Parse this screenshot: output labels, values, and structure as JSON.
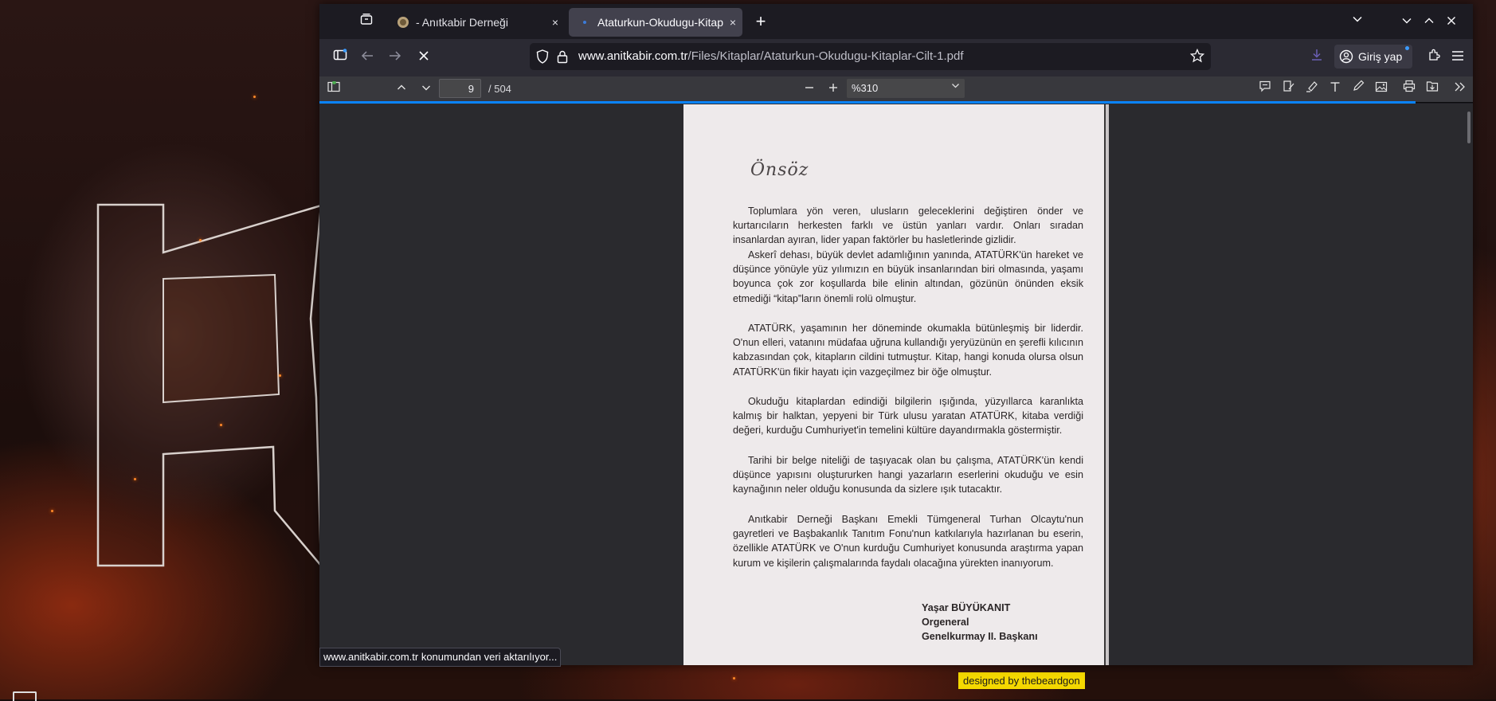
{
  "desktop": {
    "credit": "designed by thebeardgon"
  },
  "browser": {
    "tabs": [
      {
        "title": "- Anıtkabir Derneği",
        "close": "×",
        "active": false
      },
      {
        "title": "Ataturkun-Okudugu-Kitapl",
        "close": "×",
        "active": true
      }
    ],
    "new_tab": "+",
    "url": {
      "domain": "www.anitkabir.com.tr",
      "path": "/Files/Kitaplar/Ataturkun-Okudugu-Kitaplar-Cilt-1.pdf"
    },
    "account_label": "Giriş yap",
    "status_text": "www.anitkabir.com.tr konumundan veri aktarılıyor...",
    "accent_color": "#0a84ff"
  },
  "pdf_viewer": {
    "page_number": "9",
    "page_count": "/ 504",
    "zoom": "%310"
  },
  "document": {
    "heading": "Önsöz",
    "paragraphs": [
      "Toplumlara yön veren, ulusların geleceklerini değiştiren önder ve kurtarıcıların herkesten farklı ve üstün yanları vardır. Onları sıradan insanlardan ayıran, lider yapan faktörler bu hasletlerinde gizlidir.",
      "Askerî dehası, büyük devlet adamlığının yanında, ATATÜRK'ün hareket ve düşünce yönüyle yüz yılımızın en büyük insanlarından biri olmasında, yaşamı boyunca çok zor koşullarda bile elinin altından, gözünün önünden eksik etmediği “kitap”ların önemli rolü olmuştur.",
      "ATATÜRK, yaşamının her döneminde okumakla bütünleşmiş bir liderdir. O'nun elleri, vatanını müdafaa uğruna kullandığı yeryüzünün en şerefli kılıcının kabzasından çok, kitapların cildini tutmuştur. Kitap, hangi konuda olursa olsun ATATÜRK'ün fikir hayatı için vazgeçilmez bir öğe olmuştur.",
      "Okuduğu kitaplardan edindiği bilgilerin ışığında, yüzyıllarca karanlıkta kalmış bir halktan, yepyeni bir Türk ulusu yaratan ATATÜRK, kitaba verdiği değeri, kurduğu Cumhuriyet'in temelini kültüre dayandırmakla göstermiştir.",
      "Tarihi bir belge niteliği de taşıyacak olan bu çalışma, ATATÜRK'ün kendi düşünce yapısını oluştururken hangi yazarların eserlerini okuduğu ve esin kaynağının neler olduğu konusunda da sizlere ışık tutacaktır.",
      "Anıtkabir Derneği Başkanı Emekli Tümgeneral Turhan Olcaytu'nun gayretleri ve Başbakanlık Tanıtım Fonu'nun katkılarıyla hazırlanan bu eserin, özellikle ATATÜRK ve O'nun kurduğu Cumhuriyet konusunda araştırma yapan kurum ve kişilerin çalışmalarında faydalı olacağına yürekten inanıyorum."
    ],
    "signature": {
      "name": "Yaşar BÜYÜKANIT",
      "rank": "Orgeneral",
      "title": "Genelkurmay II. Başkanı"
    }
  }
}
